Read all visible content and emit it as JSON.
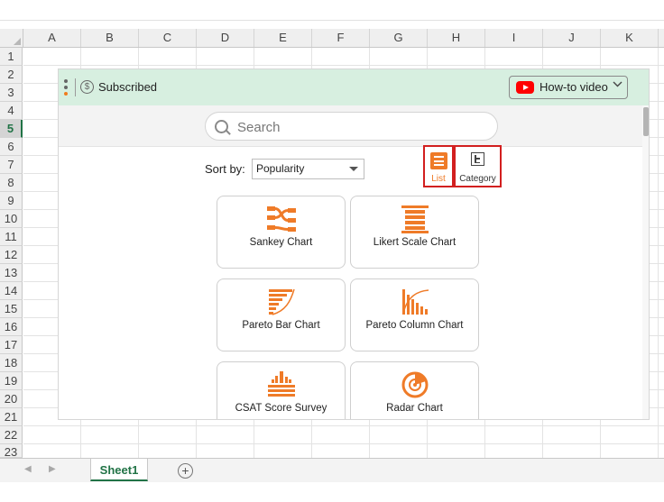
{
  "spreadsheet": {
    "columns": [
      "A",
      "B",
      "C",
      "D",
      "E",
      "F",
      "G",
      "H",
      "I",
      "J",
      "K"
    ],
    "rows": [
      "1",
      "2",
      "3",
      "4",
      "5",
      "6",
      "7",
      "8",
      "9",
      "10",
      "11",
      "12",
      "13",
      "14",
      "15",
      "16",
      "17",
      "18",
      "19",
      "20",
      "21",
      "22",
      "23"
    ],
    "active_row": "5",
    "sheet_tab": "Sheet1",
    "add_sheet_symbol": "+"
  },
  "panel": {
    "subscription": {
      "label": "Subscribed",
      "icon": "dollar-circle-icon"
    },
    "howto": {
      "label": "How-to video",
      "icon": "youtube-icon"
    },
    "search": {
      "placeholder": "Search",
      "value": ""
    },
    "sort": {
      "label": "Sort by:",
      "value": "Popularity"
    },
    "view_toggle": {
      "list_label": "List",
      "category_label": "Category",
      "active": "List"
    },
    "cards": [
      {
        "label": "Sankey Chart",
        "icon": "sankey-icon"
      },
      {
        "label": "Likert Scale Chart",
        "icon": "likert-icon"
      },
      {
        "label": "Pareto Bar Chart",
        "icon": "pareto-bar-icon"
      },
      {
        "label": "Pareto Column Chart",
        "icon": "pareto-column-icon"
      },
      {
        "label": "CSAT Score Survey",
        "icon": "csat-icon"
      },
      {
        "label": "Radar Chart",
        "icon": "radar-icon"
      }
    ]
  },
  "colors": {
    "accent_orange": "#ef7b28",
    "header_green": "#d7efe0",
    "excel_green": "#217346",
    "highlight_red": "#d21f1f"
  }
}
